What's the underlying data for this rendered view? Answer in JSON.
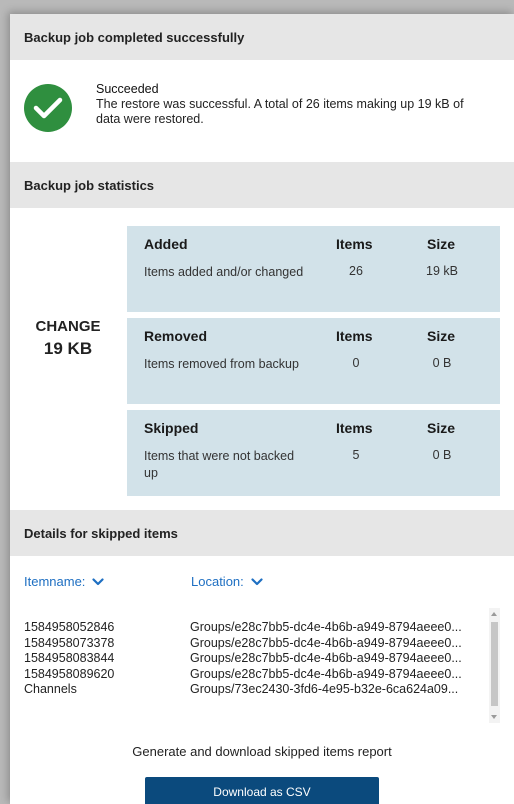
{
  "header": {
    "title": "Backup job completed successfully"
  },
  "result": {
    "status": "Succeeded",
    "message": "The restore was successful. A total of 26 items making up 19 kB of data were restored."
  },
  "stats": {
    "title": "Backup job statistics",
    "change_label": "CHANGE",
    "change_value": "19 KB",
    "items_header": "Items",
    "size_header": "Size",
    "cards": [
      {
        "title": "Added",
        "description": "Items added and/or changed",
        "items": "26",
        "size": "19 kB"
      },
      {
        "title": "Removed",
        "description": "Items removed from backup",
        "items": "0",
        "size": "0 B"
      },
      {
        "title": "Skipped",
        "description": "Items that were not backed up",
        "items": "5",
        "size": "0 B"
      }
    ]
  },
  "skipped": {
    "title": "Details for skipped items",
    "col_itemname": "Itemname:",
    "col_location": "Location:",
    "rows": [
      {
        "name": "1584958052846",
        "location": "Groups/e28c7bb5-dc4e-4b6b-a949-8794aeee0..."
      },
      {
        "name": "1584958073378",
        "location": "Groups/e28c7bb5-dc4e-4b6b-a949-8794aeee0..."
      },
      {
        "name": "1584958083844",
        "location": "Groups/e28c7bb5-dc4e-4b6b-a949-8794aeee0..."
      },
      {
        "name": "1584958089620",
        "location": "Groups/e28c7bb5-dc4e-4b6b-a949-8794aeee0..."
      },
      {
        "name": "Channels",
        "location": "Groups/73ec2430-3fd6-4e95-b32e-6ca624a09..."
      }
    ],
    "report_text": "Generate and download skipped items report",
    "download_label": "Download as CSV"
  },
  "colors": {
    "success_green": "#2f8f3f",
    "card_bg": "#d2e2e9",
    "link_blue": "#1e6fc2",
    "button_bg": "#0b4a7d"
  },
  "icons": [
    "checkmark-icon",
    "chevron-down-icon"
  ]
}
